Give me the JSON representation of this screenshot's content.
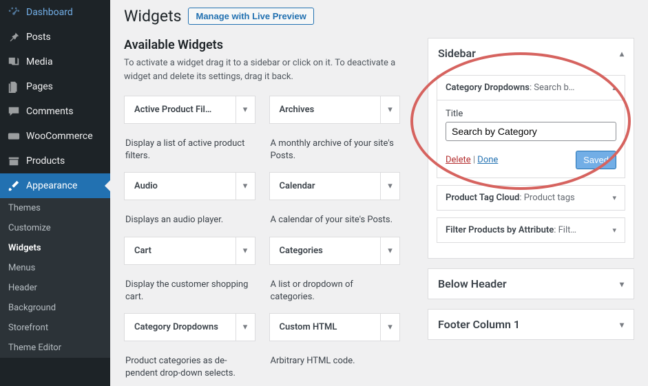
{
  "nav": [
    {
      "id": "dashboard",
      "icon": "gauge",
      "label": "Dashboard"
    },
    {
      "id": "posts",
      "icon": "pin",
      "label": "Posts"
    },
    {
      "id": "media",
      "icon": "media",
      "label": "Media"
    },
    {
      "id": "pages",
      "icon": "pages",
      "label": "Pages"
    },
    {
      "id": "comments",
      "icon": "comment",
      "label": "Comments"
    },
    {
      "id": "woocommerce",
      "icon": "woo",
      "label": "WooCommerce"
    },
    {
      "id": "products",
      "icon": "archive",
      "label": "Products"
    },
    {
      "id": "appearance",
      "icon": "brush",
      "label": "Appearance"
    }
  ],
  "appearance_sub": [
    {
      "label": "Themes"
    },
    {
      "label": "Customize"
    },
    {
      "label": "Widgets",
      "current": true
    },
    {
      "label": "Menus"
    },
    {
      "label": "Header"
    },
    {
      "label": "Background"
    },
    {
      "label": "Storefront"
    },
    {
      "label": "Theme Editor"
    }
  ],
  "page": {
    "title": "Widgets",
    "live_preview": "Manage with Live Preview",
    "available_title": "Available Widgets",
    "available_desc": "To activate a widget drag it to a sidebar or click on it. To deactivate a widget and delete its settings, drag it back."
  },
  "available": [
    {
      "title": "Active Product Fil…",
      "desc": "Display a list of active prod­uct filters."
    },
    {
      "title": "Archives",
      "desc": "A monthly archive of your site's Posts."
    },
    {
      "title": "Audio",
      "desc": "Displays an audio player."
    },
    {
      "title": "Calendar",
      "desc": "A calendar of your site's Posts."
    },
    {
      "title": "Cart",
      "desc": "Display the customer shop­ping cart."
    },
    {
      "title": "Categories",
      "desc": "A list or dropdown of categories."
    },
    {
      "title": "Category Dropdowns",
      "desc": "Product categories as de­pendent drop-down selects."
    },
    {
      "title": "Custom HTML",
      "desc": "Arbitrary HTML code."
    }
  ],
  "sidebar_area": {
    "title": "Sidebar",
    "widgets": [
      {
        "name": "Category Dropdowns",
        "extra": "Search b…",
        "open": true,
        "title_label": "Title",
        "title_value": "Search by Category",
        "delete": "Delete",
        "done": "Done",
        "saved": "Saved"
      },
      {
        "name": "Product Tag Cloud",
        "extra": "Product tags"
      },
      {
        "name": "Filter Products by Attribute",
        "extra": "Filt…"
      }
    ]
  },
  "other_areas": [
    {
      "title": "Below Header"
    },
    {
      "title": "Footer Column 1"
    }
  ]
}
